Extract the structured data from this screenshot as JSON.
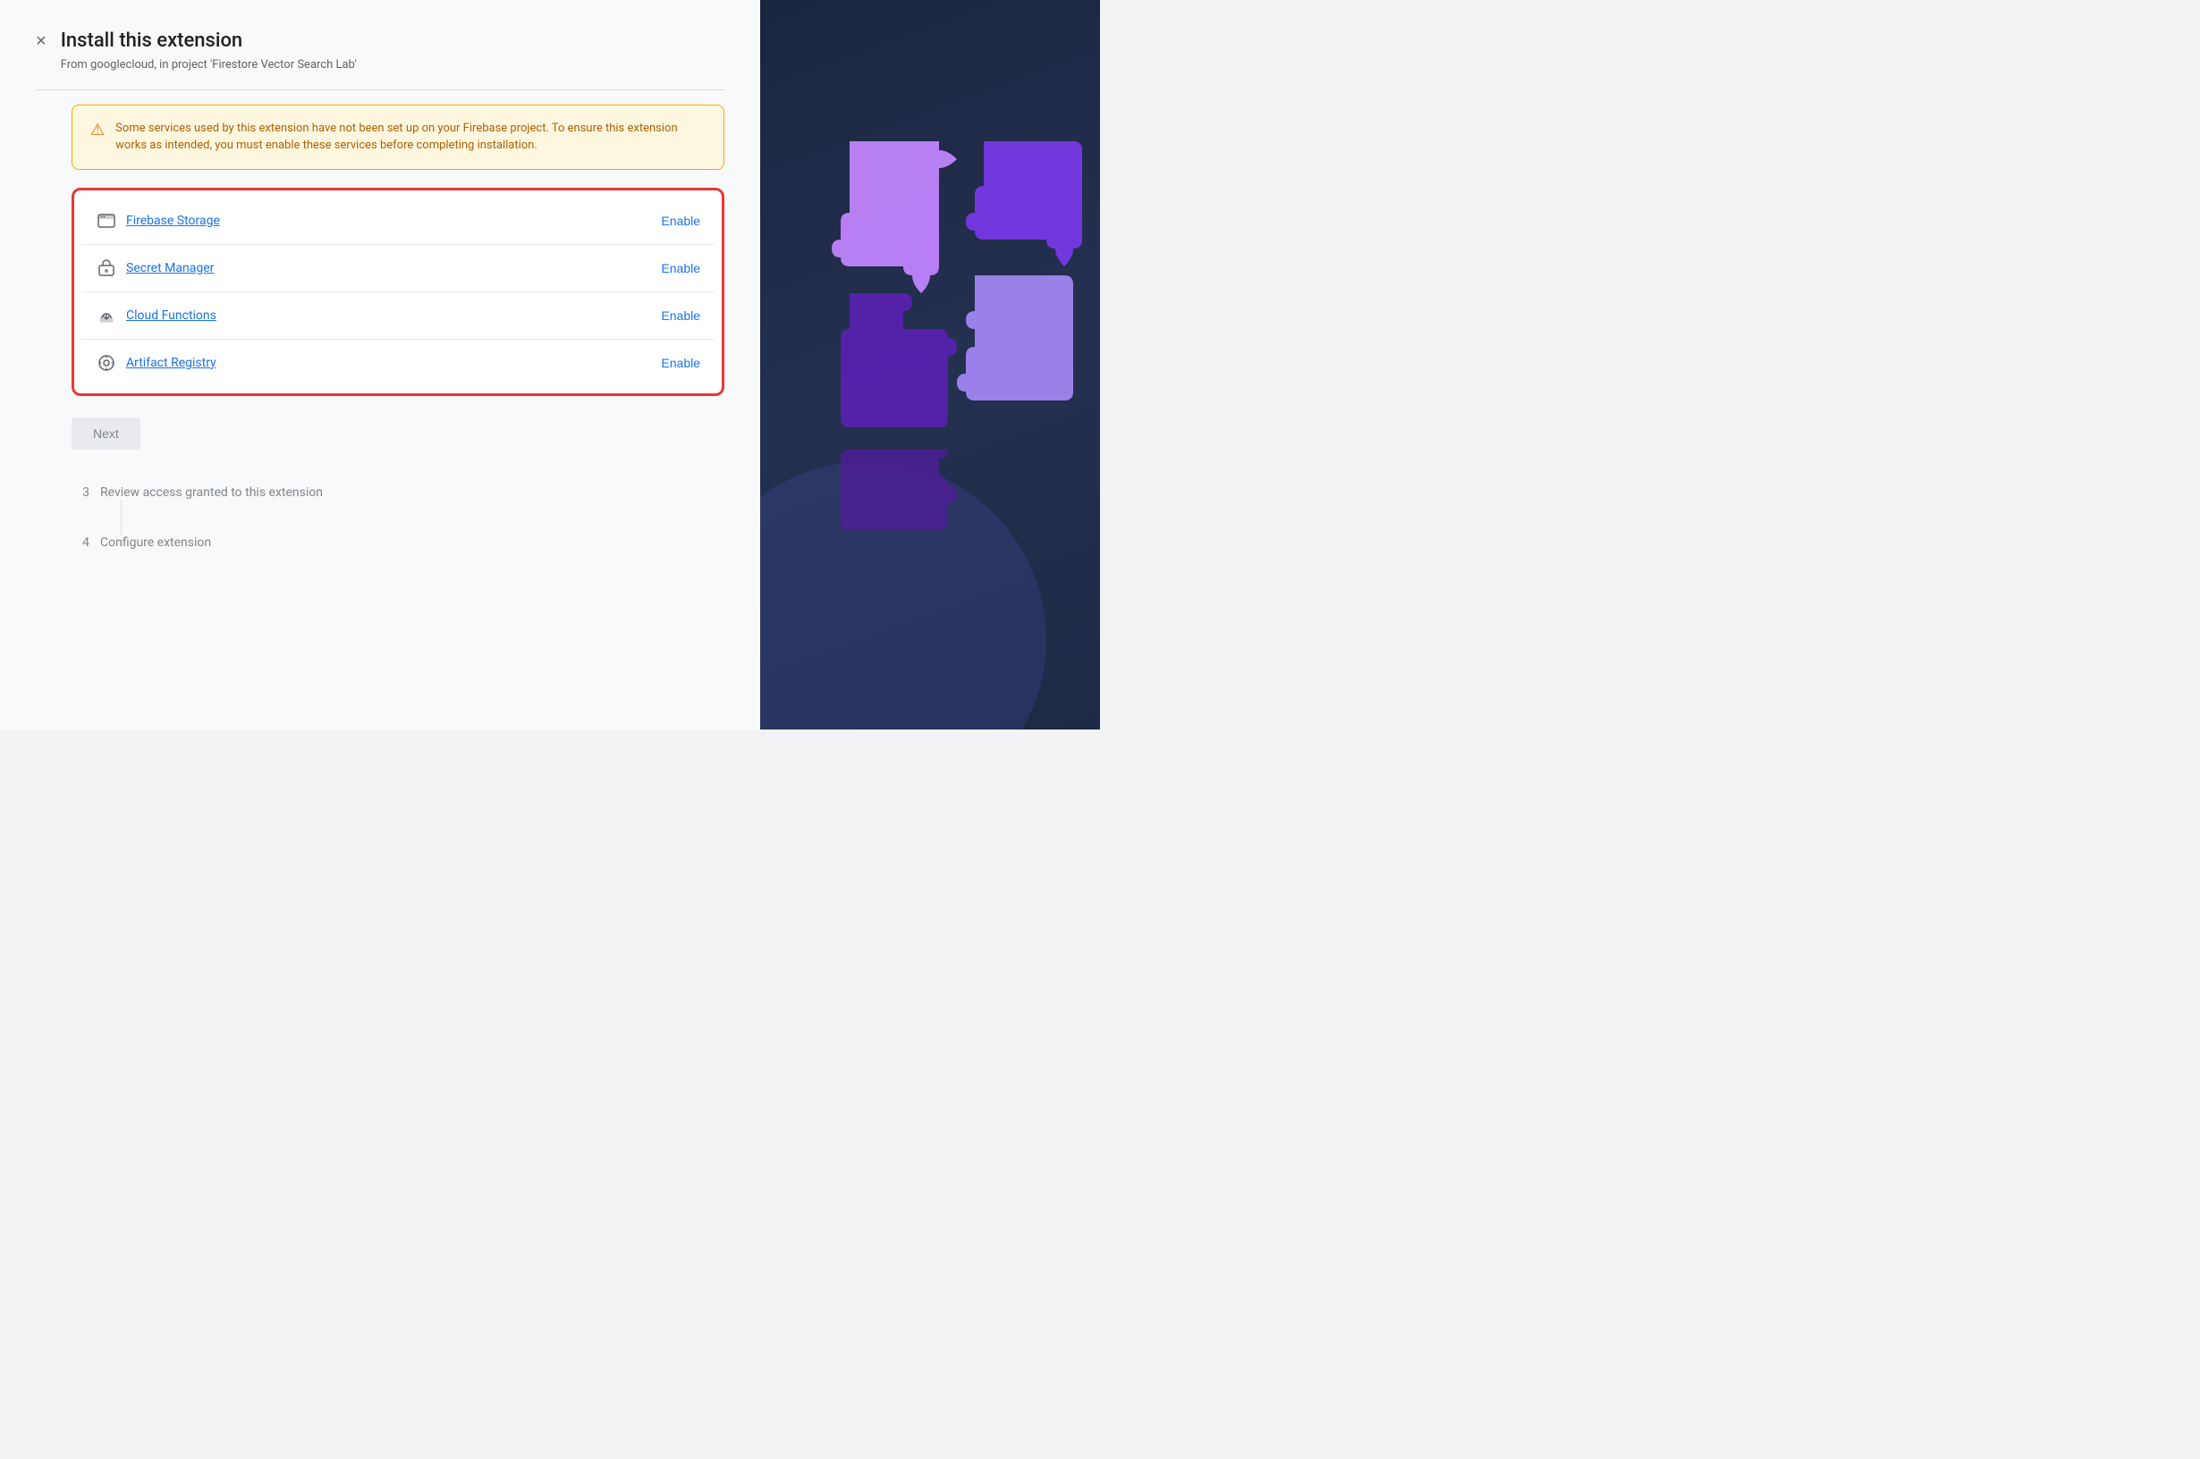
{
  "header": {
    "title": "Install this extension",
    "subtitle": "From googlecloud, in project 'Firestore Vector Search Lab'",
    "close_label": "×"
  },
  "warning": {
    "text": "Some services used by this extension have not been set up on your Firebase project. To ensure this extension works as intended, you must enable these services before completing installation."
  },
  "services": [
    {
      "name": "Firebase Storage",
      "enable_label": "Enable",
      "icon": "🖼"
    },
    {
      "name": "Secret Manager",
      "enable_label": "Enable",
      "icon": "[·]"
    },
    {
      "name": "Cloud Functions",
      "enable_label": "Enable",
      "icon": "{·}"
    },
    {
      "name": "Artifact Registry",
      "enable_label": "Enable",
      "icon": "⚙"
    }
  ],
  "next_button": "Next",
  "steps": [
    {
      "number": "3",
      "label": "Review access granted to this extension"
    },
    {
      "number": "4",
      "label": "Configure extension"
    }
  ]
}
